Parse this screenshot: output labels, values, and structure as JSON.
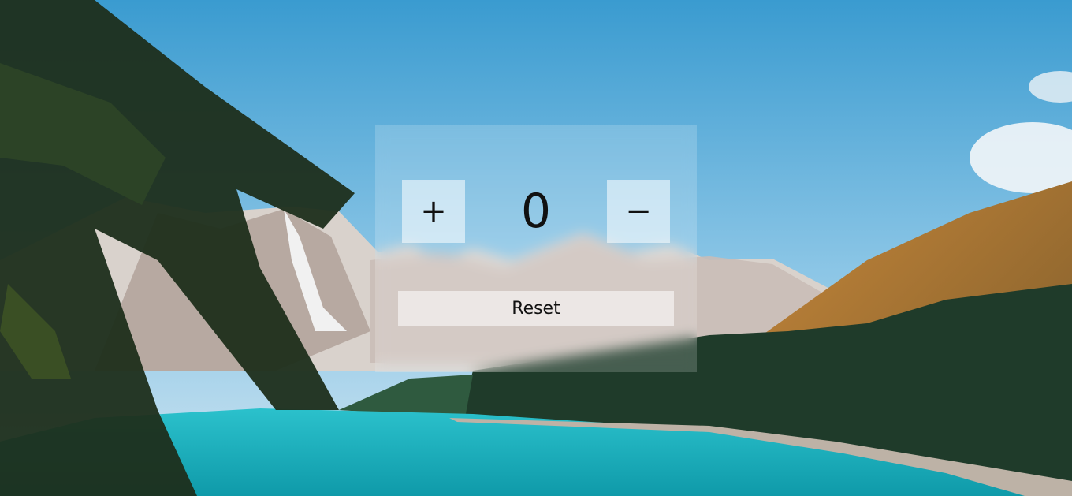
{
  "counter": {
    "increment_label": "+",
    "value": "0",
    "decrement_label": "−",
    "reset_label": "Reset"
  },
  "icons": {
    "increment": "plus-icon",
    "decrement": "minus-icon"
  },
  "colors": {
    "sky": "#4aa7d6",
    "lake": "#1fb5c3",
    "forest": "#1f3b2a",
    "hill": "#b7772d",
    "panel": "rgba(255,255,255,0.18)",
    "button": "rgba(255,255,255,0.55)"
  }
}
